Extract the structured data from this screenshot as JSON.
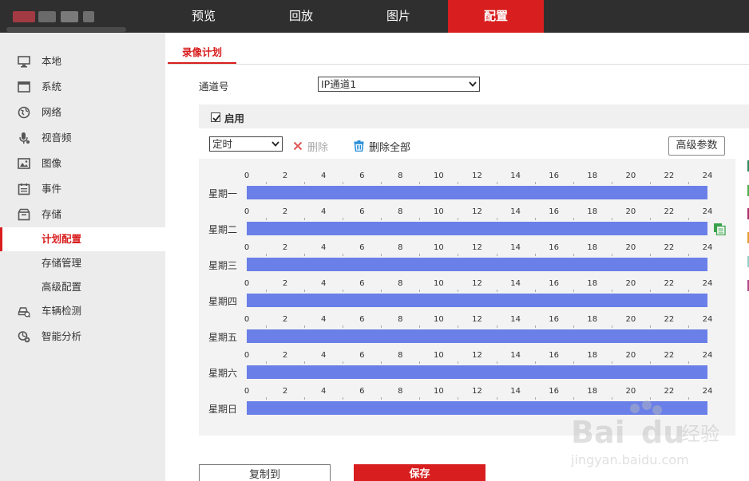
{
  "nav": {
    "tabs": [
      {
        "label": "预览"
      },
      {
        "label": "回放"
      },
      {
        "label": "图片"
      },
      {
        "label": "配置"
      }
    ],
    "active_index": 3
  },
  "sidebar": {
    "items": [
      {
        "label": "本地",
        "icon": "monitor-icon"
      },
      {
        "label": "系统",
        "icon": "system-window-icon"
      },
      {
        "label": "网络",
        "icon": "globe-icon"
      },
      {
        "label": "视音频",
        "icon": "microphone-icon"
      },
      {
        "label": "图像",
        "icon": "image-icon"
      },
      {
        "label": "事件",
        "icon": "calendar-icon"
      },
      {
        "label": "存储",
        "icon": "storage-box-icon"
      },
      {
        "label": "计划配置",
        "sub": true,
        "active": true
      },
      {
        "label": "存储管理",
        "sub": true
      },
      {
        "label": "高级配置",
        "sub": true
      },
      {
        "label": "车辆检测",
        "icon": "vehicle-detection-icon"
      },
      {
        "label": "智能分析",
        "icon": "smart-analysis-icon"
      }
    ]
  },
  "page_tab": "录像计划",
  "channel": {
    "label": "通道号",
    "value": "IP通道1"
  },
  "enable": {
    "label": "启用",
    "checked": true
  },
  "toolbar": {
    "mode_value": "定时",
    "delete_label": "删除",
    "delete_all_label": "删除全部",
    "advanced_label": "高级参数"
  },
  "schedule": {
    "ticks": [
      "0",
      "2",
      "4",
      "6",
      "8",
      "10",
      "12",
      "14",
      "16",
      "18",
      "20",
      "22",
      "24"
    ],
    "days": [
      {
        "label": "星期一",
        "segments": [
          [
            0,
            24
          ]
        ]
      },
      {
        "label": "星期二",
        "segments": [
          [
            0,
            24
          ]
        ]
      },
      {
        "label": "星期三",
        "segments": [
          [
            0,
            24
          ]
        ]
      },
      {
        "label": "星期四",
        "segments": [
          [
            0,
            24
          ]
        ]
      },
      {
        "label": "星期五",
        "segments": [
          [
            0,
            24
          ]
        ]
      },
      {
        "label": "星期六",
        "segments": [
          [
            0,
            24
          ]
        ]
      },
      {
        "label": "星期日",
        "segments": [
          [
            0,
            24
          ]
        ]
      }
    ],
    "bar_color": "#6a7fe8"
  },
  "buttons": {
    "copy_label": "复制到",
    "save_label": "保存"
  },
  "colors": {
    "accent": "#d81e1e",
    "topbar": "#2f2f2f"
  }
}
